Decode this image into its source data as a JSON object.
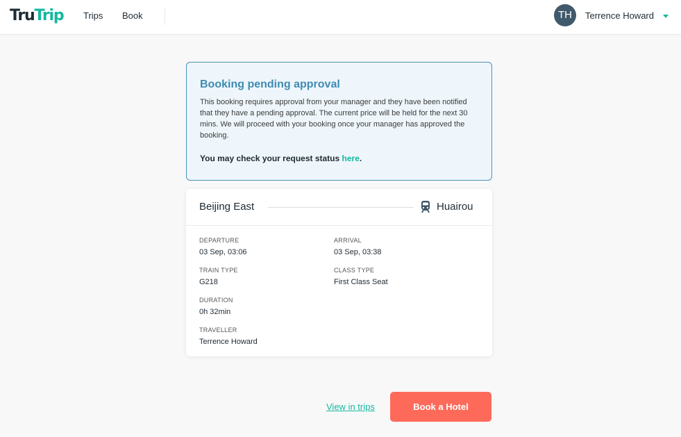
{
  "header": {
    "logo_part1": "Tru",
    "logo_part2": "Trip",
    "nav": {
      "trips": "Trips",
      "book": "Book"
    },
    "user": {
      "initials": "TH",
      "name": "Terrence Howard"
    }
  },
  "approval": {
    "title": "Booking pending approval",
    "body": "This booking requires approval from your manager and they have been notified that they have a pending approval. The current price will be held for the next 30 mins. We will proceed with your booking once your manager has approved the booking.",
    "status_prefix": "You may check your request status ",
    "status_link": "here",
    "status_suffix": "."
  },
  "trip": {
    "origin": "Beijing East",
    "destination": "Huairou",
    "transport_icon": "train-icon",
    "fields": {
      "departure": {
        "label": "DEPARTURE",
        "value": "03 Sep, 03:06"
      },
      "arrival": {
        "label": "ARRIVAL",
        "value": "03 Sep, 03:38"
      },
      "train_type": {
        "label": "TRAIN TYPE",
        "value": "G218"
      },
      "class_type": {
        "label": "CLASS TYPE",
        "value": "First Class Seat"
      },
      "duration": {
        "label": "DURATION",
        "value": "0h 32min"
      },
      "traveller": {
        "label": "TRAVELLER",
        "value": "Terrence Howard"
      }
    }
  },
  "actions": {
    "view_trips": "View in trips",
    "book_hotel": "Book a Hotel"
  },
  "colors": {
    "brand_teal": "#14b8a0",
    "brand_navy": "#1d2b35",
    "approval_blue": "#3f8bb3",
    "cta_coral": "#fd6a5a",
    "avatar_bg": "#40596b"
  }
}
